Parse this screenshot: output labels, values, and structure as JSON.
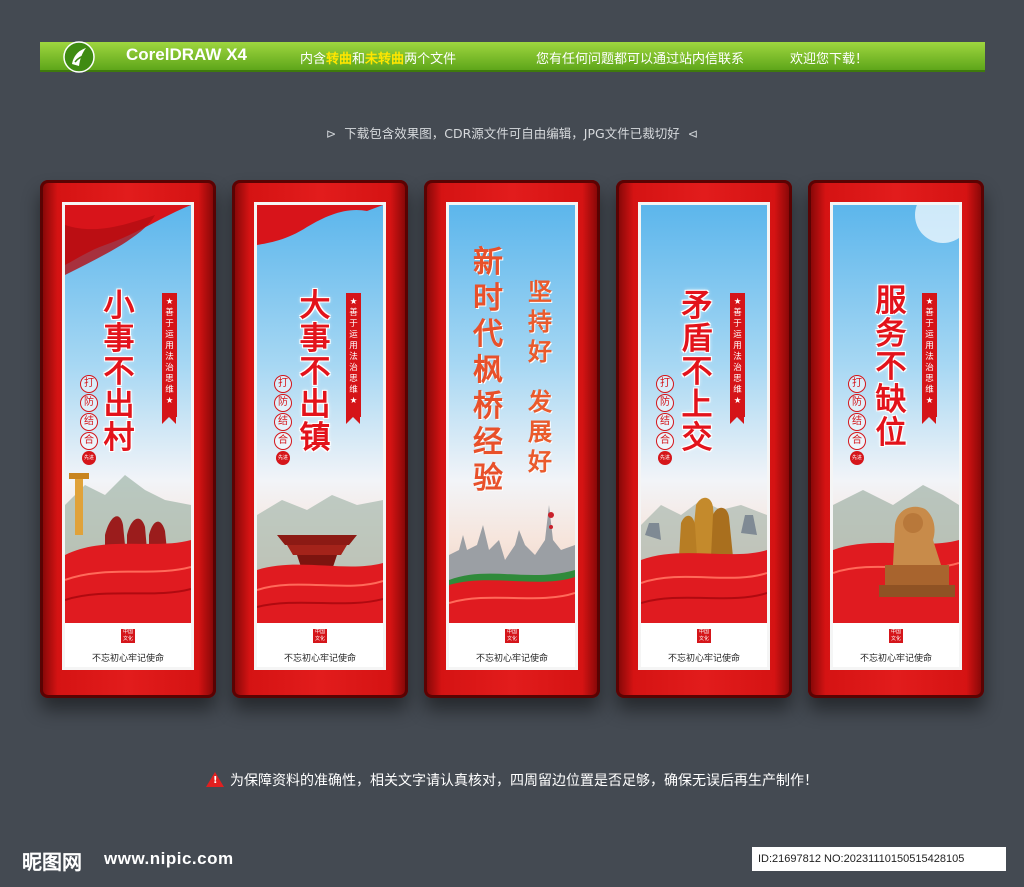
{
  "header": {
    "app_name": "CorelDRAW X4",
    "file_note_prefix": "内含",
    "file_note_converted": "转曲",
    "file_note_middle": "和",
    "file_note_unconverted": "未转曲",
    "file_note_suffix": "两个文件",
    "contact_note": "您有任何问题都可以通过站内信联系",
    "welcome_note": "欢迎您下载！"
  },
  "sub_note": "下载包含效果图，CDR源文件可自由编辑，JPG文件已裁切好",
  "panels": [
    {
      "title": "小事不出村",
      "ribbon": "★善于运用法治思维★",
      "seals": [
        "打",
        "防",
        "结",
        "合"
      ],
      "seal_small": "先进",
      "stamp": "中国文化",
      "motto": "不忘初心牢记使命"
    },
    {
      "title": "大事不出镇",
      "ribbon": "★善于运用法治思维★",
      "seals": [
        "打",
        "防",
        "结",
        "合"
      ],
      "seal_small": "先进",
      "stamp": "中国文化",
      "motto": "不忘初心牢记使命"
    },
    {
      "title_main": "新时代枫桥经验",
      "title_right_top": "坚持好",
      "title_right_bottom": "发展好",
      "stamp": "中国文化",
      "motto": "不忘初心牢记使命"
    },
    {
      "title": "矛盾不上交",
      "ribbon": "★善于运用法治思维★",
      "seals": [
        "打",
        "防",
        "结",
        "合"
      ],
      "seal_small": "先进",
      "stamp": "中国文化",
      "motto": "不忘初心牢记使命"
    },
    {
      "title": "服务不缺位",
      "ribbon": "★善于运用法治思维★",
      "seals": [
        "打",
        "防",
        "结",
        "合"
      ],
      "seal_small": "先进",
      "stamp": "中国文化",
      "motto": "不忘初心牢记使命"
    }
  ],
  "warning": "为保障资料的准确性，相关文字请认真核对，四周留边位置是否足够，确保无误后再生产制作！",
  "footer": {
    "site_logo": "昵图网",
    "site_url": "www.nipic.com",
    "id_text": "ID:21697812 NO:20231110150515428105"
  },
  "colors": {
    "background": "#444a52",
    "banner_green": "#7cc22a",
    "panel_red": "#e21c1c",
    "title_red": "#e3131b",
    "calligraphy_orange": "#e8502a"
  }
}
